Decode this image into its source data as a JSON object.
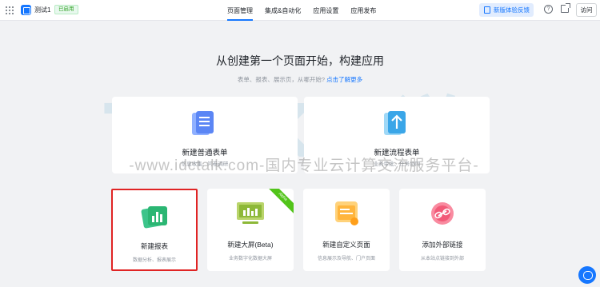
{
  "app": {
    "name": "测试1",
    "status": "已启用"
  },
  "nav": {
    "tabs": [
      "页面管理",
      "集成&自动化",
      "应用设置",
      "应用发布"
    ],
    "active_index": 0
  },
  "toolbar": {
    "feedback_label": "新版体验反馈",
    "help": "?",
    "visit_label": "访问"
  },
  "hero": {
    "headline": "从创建第一个页面开始，构建应用",
    "subline": "表单、报表、展示页，从哪开始?",
    "learn_more": "点击了解更多"
  },
  "big_cards": [
    {
      "title": "新建普通表单",
      "desc": "信息收集、问卷调研"
    },
    {
      "title": "新建流程表单",
      "desc": "业务审批、任务协同"
    }
  ],
  "cards": [
    {
      "title": "新建报表",
      "desc": "数据分析、报表展示",
      "selected": true
    },
    {
      "title": "新建大屏(Beta)",
      "desc": "业务数字化数据大屏",
      "badge": "Alpha"
    },
    {
      "title": "新建自定义页面",
      "desc": "信息展示及导航、门户页面"
    },
    {
      "title": "添加外部链接",
      "desc": "从本站点链接到外部"
    }
  ],
  "watermark": {
    "logo": "TALK云说",
    "url": "-www.idctalk.com-国内专业云计算交流服务平台-"
  }
}
